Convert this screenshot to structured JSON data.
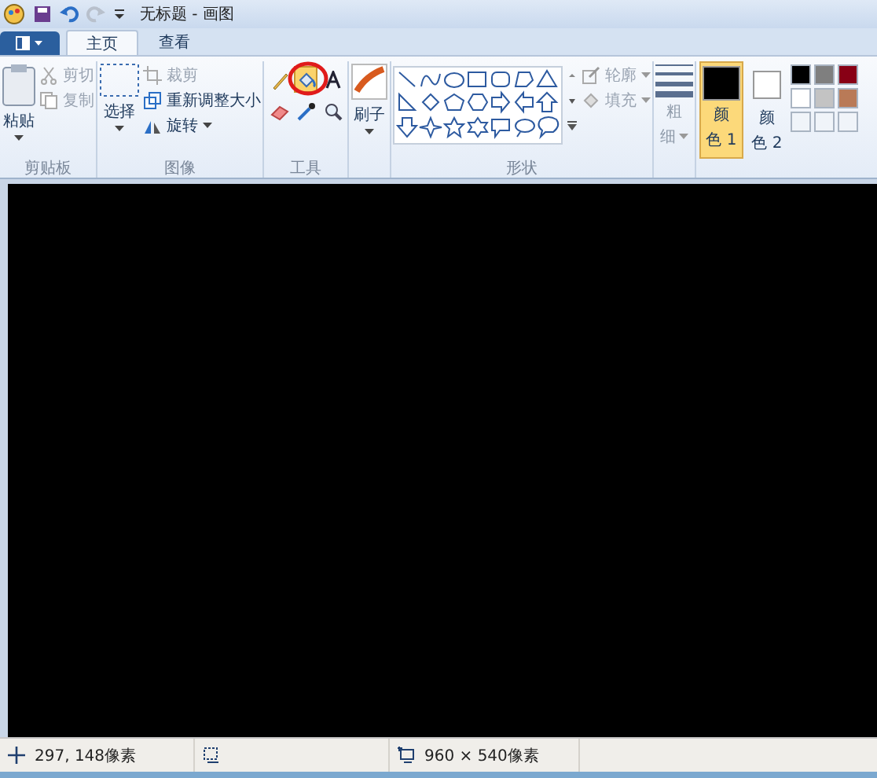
{
  "window": {
    "title": "无标题 - 画图"
  },
  "tabs": [
    {
      "label": "主页",
      "selected": true
    },
    {
      "label": "查看",
      "selected": false
    }
  ],
  "clipboard": {
    "paste": "粘贴",
    "cut": "剪切",
    "copy": "复制",
    "label": "剪贴板"
  },
  "image": {
    "select": "选择",
    "crop": "裁剪",
    "resize": "重新调整大小",
    "rotate": "旋转",
    "label": "图像"
  },
  "tools": {
    "items": [
      {
        "kind": "pencil",
        "selected": false
      },
      {
        "kind": "fill",
        "selected": true
      },
      {
        "kind": "text",
        "selected": false
      },
      {
        "kind": "eraser",
        "selected": false
      },
      {
        "kind": "picker",
        "selected": false
      },
      {
        "kind": "magnifier",
        "selected": false
      }
    ],
    "label": "工具"
  },
  "brush": {
    "label": "刷子"
  },
  "shapes": {
    "outline": "轮廓",
    "fill": "填充",
    "label": "形状"
  },
  "size": {
    "line1": "粗",
    "line2": "细"
  },
  "colors": [
    {
      "line1": "颜",
      "line2": "色 1",
      "color": "#000000",
      "selected": true
    },
    {
      "line1": "颜",
      "line2": "色 2",
      "color": "#ffffff",
      "selected": false
    }
  ],
  "palette": [
    {
      "color": "#000000"
    },
    {
      "color": "#7f7f7f"
    },
    {
      "color": "#880015"
    },
    {
      "color": "#ffffff"
    },
    {
      "color": "#c3c3c3"
    },
    {
      "color": "#b97a57"
    }
  ],
  "status_bar": {
    "position": "297, 148像素",
    "canvas_size": "960 × 540像素"
  }
}
